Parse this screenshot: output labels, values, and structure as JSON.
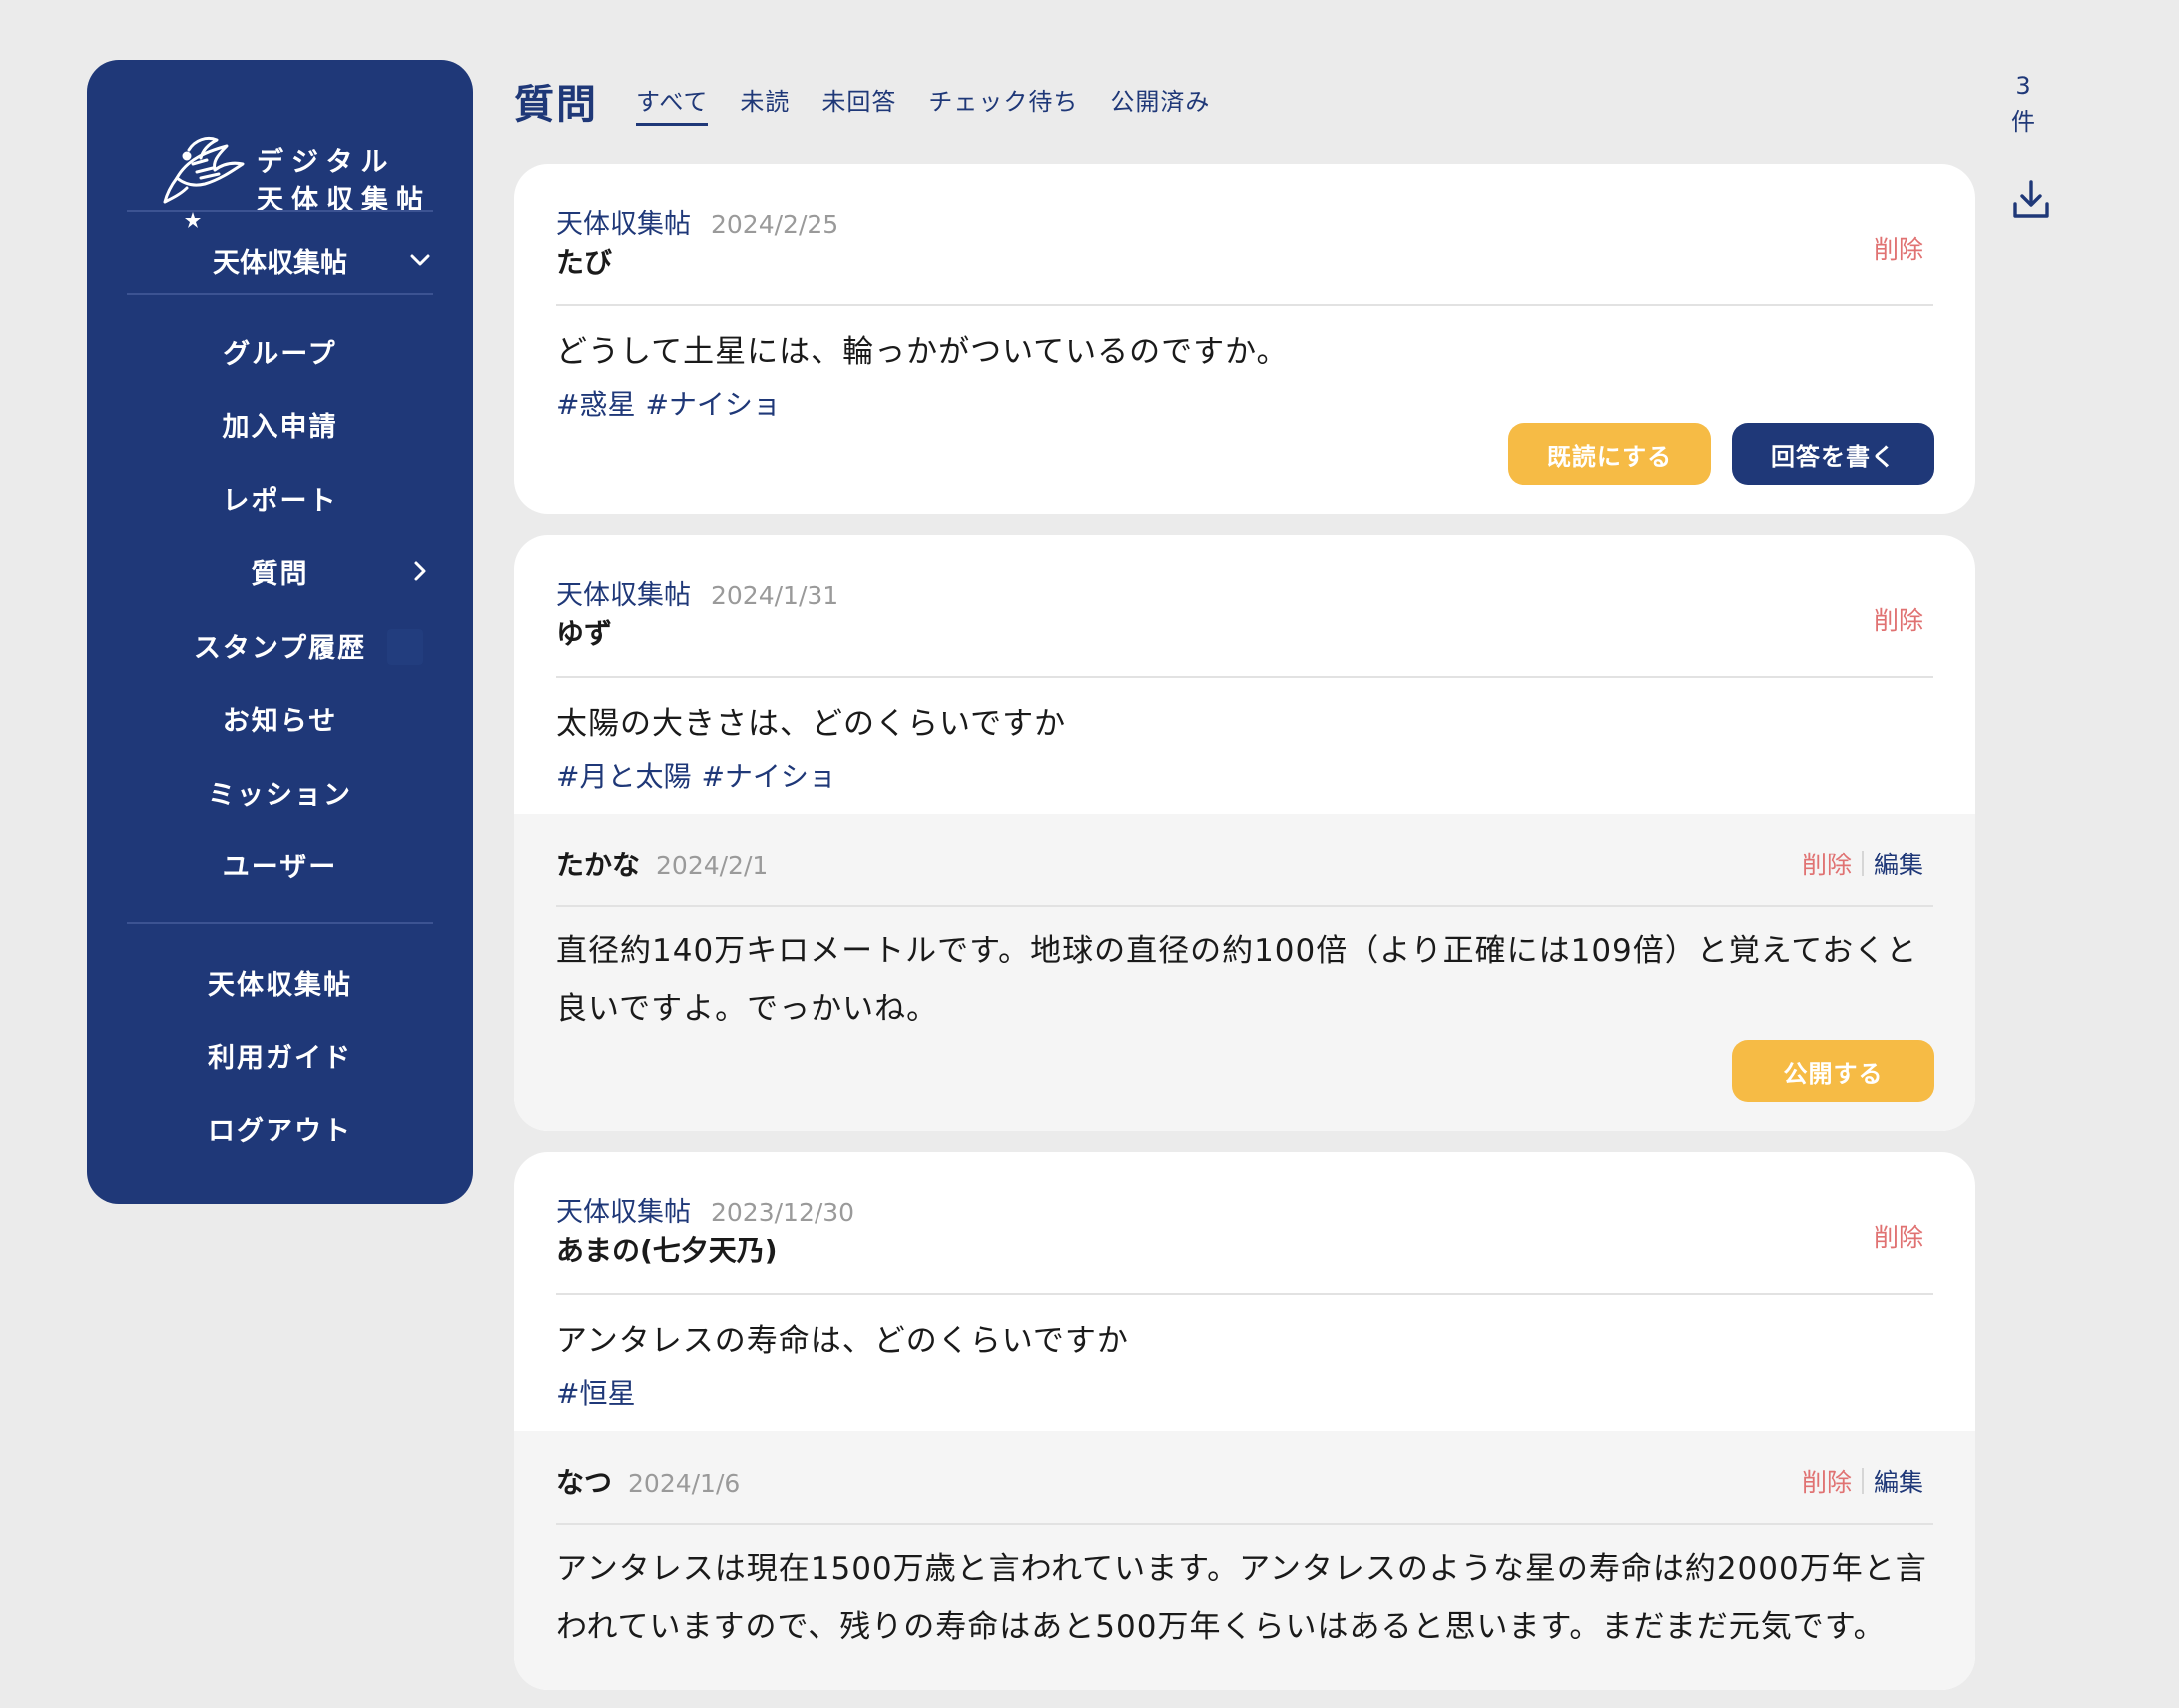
{
  "brand": {
    "name_line1": "デジタル",
    "name_line2": "天体収集帖",
    "logo_icon": "eagle-star-icon"
  },
  "sidebar": {
    "collection_select": "天体収集帖",
    "nav": [
      {
        "label": "グループ"
      },
      {
        "label": "加入申請"
      },
      {
        "label": "レポート"
      },
      {
        "label": "質問"
      },
      {
        "label": "スタンプ履歴"
      },
      {
        "label": "お知らせ"
      },
      {
        "label": "ミッション"
      },
      {
        "label": "ユーザー"
      }
    ],
    "footer": [
      {
        "label": "天体収集帖"
      },
      {
        "label": "利用ガイド"
      },
      {
        "label": "ログアウト"
      }
    ]
  },
  "header": {
    "title": "質問",
    "tabs": [
      {
        "label": "すべて",
        "active": true
      },
      {
        "label": "未読"
      },
      {
        "label": "未回答"
      },
      {
        "label": "チェック待ち"
      },
      {
        "label": "公開済み"
      }
    ],
    "count_number": "3",
    "count_unit": "件",
    "download_icon": "download-icon"
  },
  "questions": [
    {
      "collection": "天体収集帖",
      "date": "2024/2/25",
      "author": "たび",
      "delete": "削除",
      "text": "どうして土星には、輪っかがついているのですか。",
      "tags": [
        "#惑星",
        "#ナイショ"
      ],
      "mark_read": "既読にする",
      "write_answer": "回答を書く"
    },
    {
      "collection": "天体収集帖",
      "date": "2024/1/31",
      "author": "ゆず",
      "delete": "削除",
      "text": "太陽の大きさは、どのくらいですか",
      "tags": [
        "#月と太陽",
        "#ナイショ"
      ],
      "answer": {
        "author": "たかな",
        "date": "2024/2/1",
        "delete": "削除",
        "edit": "編集",
        "text": "直径約140万キロメートルです。地球の直径の約100倍（より正確には109倍）と覚えておくと良いですよ。でっかいね。",
        "publish": "公開する"
      }
    },
    {
      "collection": "天体収集帖",
      "date": "2023/12/30",
      "author": "あまの(七夕天乃)",
      "delete": "削除",
      "text": "アンタレスの寿命は、どのくらいですか",
      "tags": [
        "#恒星"
      ],
      "answer": {
        "author": "なつ",
        "date": "2024/1/6",
        "delete": "削除",
        "edit": "編集",
        "text": "アンタレスは現在1500万歳と言われています。アンタレスのような星の寿命は約2000万年と言われていますので、残りの寿命はあと500万年くらいはあると思います。まだまだ元気です。"
      }
    }
  ],
  "colors": {
    "navy": "#1f3878",
    "yellow": "#f6bb45",
    "danger": "#e07272",
    "background": "#ebebeb"
  }
}
